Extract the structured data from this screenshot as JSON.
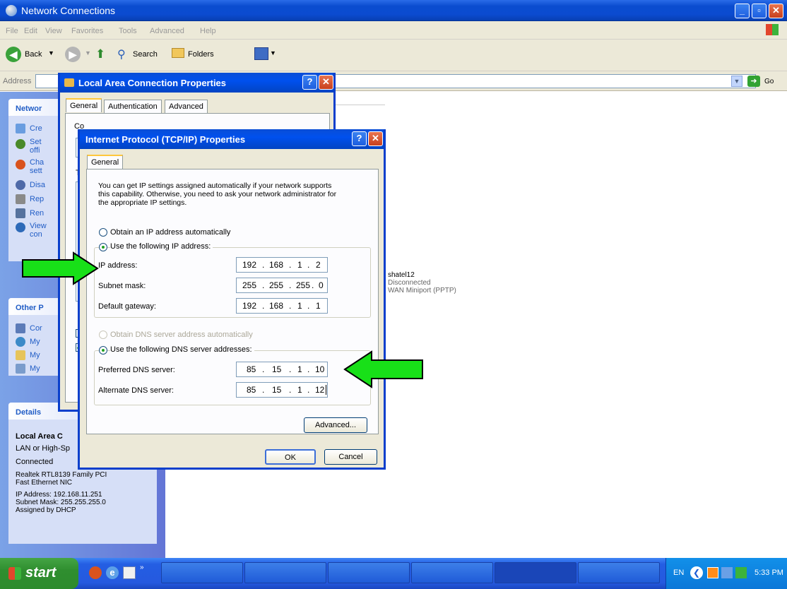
{
  "window": {
    "title": "Network Connections"
  },
  "menu": [
    "File",
    "Edit",
    "View",
    "Favorites",
    "Tools",
    "Advanced",
    "Help"
  ],
  "toolbar": {
    "back": "Back",
    "search": "Search",
    "folders": "Folders"
  },
  "address": {
    "label": "Address",
    "go": "Go"
  },
  "left_pane": {
    "network_tasks_title": "Networ",
    "network_tasks": [
      "Cre",
      "Set",
      "offi",
      "Cha",
      "sett",
      "Disa",
      "Rep",
      "Ren",
      "View",
      "con"
    ],
    "other_places_title": "Other P",
    "other_places": [
      "Cor",
      "My",
      "My",
      "My"
    ],
    "details_title": "Details",
    "details": {
      "name": "Local Area C",
      "type": "LAN or High-Sp",
      "status": "Connected",
      "device1": "Realtek RTL8139 Family PCI",
      "device2": "Fast Ethernet NIC",
      "ip": "IP Address: 192.168.11.251",
      "mask": "Subnet Mask: 255.255.255.0",
      "assigned": "Assigned by DHCP"
    }
  },
  "connection": {
    "name": "shatel12",
    "status": "Disconnected",
    "device": "WAN Miniport (PPTP)"
  },
  "lac_dialog": {
    "title": "Local Area Connection Properties",
    "tabs": [
      "General",
      "Authentication",
      "Advanced"
    ],
    "fragment1": "Co",
    "fragment2": "T"
  },
  "tcp_dialog": {
    "title": "Internet Protocol (TCP/IP) Properties",
    "tab": "General",
    "intro1": "You can get IP settings assigned automatically if your network supports",
    "intro2": "this capability. Otherwise, you need to ask your network administrator for",
    "intro3": "the appropriate IP settings.",
    "opt_auto_ip": "Obtain an IP address automatically",
    "opt_manual_ip": "Use the following IP address:",
    "ip_label": "IP address:",
    "ip": [
      "192",
      "168",
      "1",
      "2"
    ],
    "mask_label": "Subnet mask:",
    "mask": [
      "255",
      "255",
      "255",
      "0"
    ],
    "gw_label": "Default gateway:",
    "gw": [
      "192",
      "168",
      "1",
      "1"
    ],
    "opt_auto_dns": "Obtain DNS server address automatically",
    "opt_manual_dns": "Use the following DNS server addresses:",
    "pdns_label": "Preferred DNS server:",
    "pdns": [
      "85",
      "15",
      "1",
      "10"
    ],
    "adns_label": "Alternate DNS server:",
    "adns": [
      "85",
      "15",
      "1",
      "12"
    ],
    "advanced": "Advanced...",
    "ok": "OK",
    "cancel": "Cancel"
  },
  "taskbar": {
    "start": "start",
    "lang": "EN",
    "time": "5:33 PM"
  }
}
